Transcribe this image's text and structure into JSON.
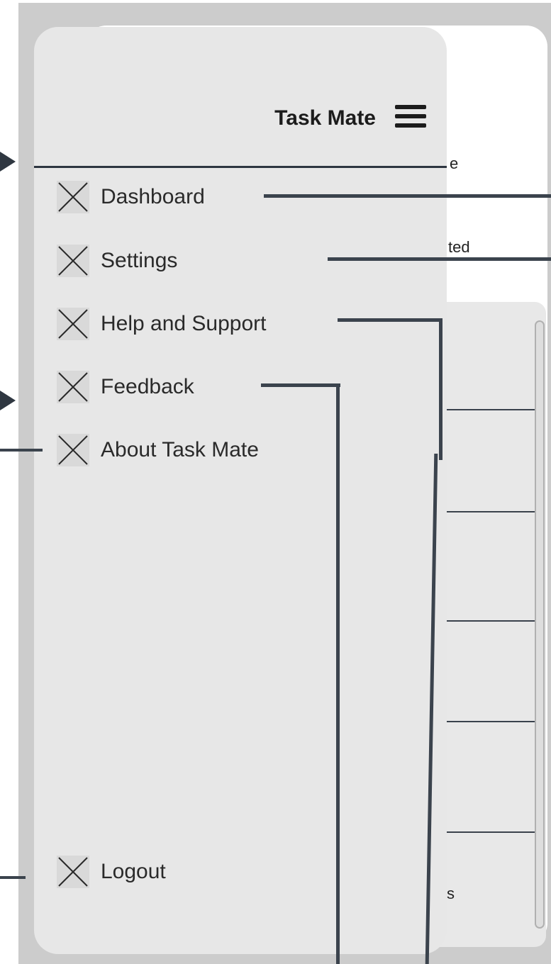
{
  "background_screen": {
    "fragment_1": "e",
    "fragment_2": "ted",
    "fragment_3": "s"
  },
  "drawer": {
    "title": "Task Mate",
    "menu_icon": "hamburger-menu-icon",
    "items": [
      {
        "label": "Dashboard",
        "icon": "placeholder-x-icon"
      },
      {
        "label": "Settings",
        "icon": "placeholder-x-icon"
      },
      {
        "label": "Help and Support",
        "icon": "placeholder-x-icon"
      },
      {
        "label": "Feedback",
        "icon": "placeholder-x-icon"
      },
      {
        "label": "About Task Mate",
        "icon": "placeholder-x-icon"
      }
    ],
    "footer_item": {
      "label": "Logout",
      "icon": "placeholder-x-icon"
    }
  },
  "colors": {
    "frame": "#cccccc",
    "drawer_bg": "#e7e7e7",
    "connector": "#3b434d",
    "text": "#2a2a2a"
  }
}
